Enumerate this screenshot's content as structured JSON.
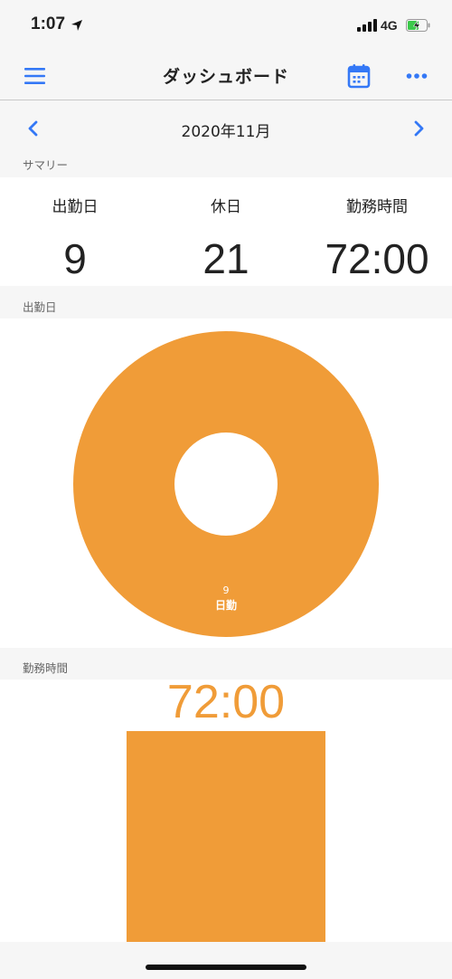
{
  "status_bar": {
    "time": "1:07",
    "network": "4G",
    "icons": [
      "location-arrow-icon",
      "signal-bars-icon",
      "battery-charging-icon"
    ]
  },
  "nav": {
    "title": "ダッシュボード",
    "left_icon": "hamburger-menu-icon",
    "right_icons": [
      "calendar-icon",
      "more-horizontal-icon"
    ]
  },
  "month": {
    "label": "2020年11月",
    "prev_icon": "chevron-left-icon",
    "next_icon": "chevron-right-icon"
  },
  "summary": {
    "section_label": "サマリー",
    "items": [
      {
        "label": "出勤日",
        "value": "9"
      },
      {
        "label": "休日",
        "value": "21"
      },
      {
        "label": "勤務時間",
        "value": "72:00"
      }
    ]
  },
  "attendance_chart": {
    "section_label": "出勤日"
  },
  "hours_chart": {
    "section_label": "勤務時間"
  },
  "colors": {
    "accent": "#3478f6",
    "chart_orange": "#f09c38",
    "background": "#f6f6f6",
    "panel": "#ffffff"
  },
  "chart_data": [
    {
      "type": "pie",
      "donut": true,
      "values": [
        9
      ],
      "data_labels": [
        {
          "value": "9",
          "label": "日勤"
        }
      ]
    },
    {
      "type": "bar",
      "values": [
        72
      ],
      "data_labels": [
        "72:00"
      ]
    }
  ]
}
